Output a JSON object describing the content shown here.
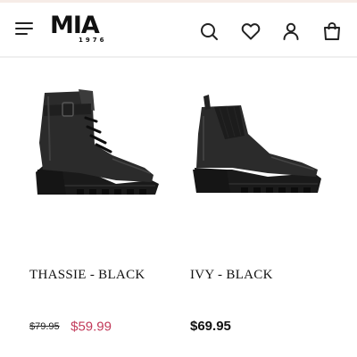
{
  "header": {
    "logo_text": "MIA",
    "logo_sub": "1976",
    "icons": [
      "menu-icon",
      "search-icon",
      "heart-icon",
      "user-icon",
      "bag-icon"
    ]
  },
  "products": [
    {
      "name": "THASSIE - BLACK",
      "original_price": "$79.95",
      "sale_price": "$59.99"
    },
    {
      "name": "IVY - BLACK",
      "price": "$69.95"
    }
  ],
  "colors": {
    "sale_price": "#c23a5a",
    "text": "#111111",
    "top_strip": "#f6ece7"
  }
}
